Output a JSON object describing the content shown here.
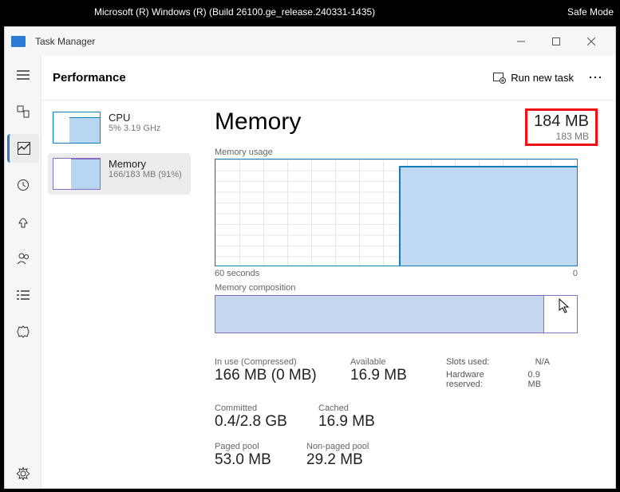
{
  "topbar": {
    "build": "Microsoft (R) Windows (R) (Build 26100.ge_release.240331-1435)",
    "mode": "Safe Mode"
  },
  "window": {
    "title": "Task Manager"
  },
  "header": {
    "title": "Performance",
    "runtask": "Run new task"
  },
  "sidebar": {
    "items": [
      {
        "name": "CPU",
        "stat": "5% 3.19 GHz"
      },
      {
        "name": "Memory",
        "stat": "166/183 MB (91%)"
      }
    ]
  },
  "detail": {
    "title": "Memory",
    "capacity": "184 MB",
    "usable": "183 MB",
    "usage_label": "Memory usage",
    "axis_left": "60 seconds",
    "axis_right": "0",
    "composition_label": "Memory composition",
    "stats": {
      "inuse_label": "In use (Compressed)",
      "inuse_val": "166 MB (0 MB)",
      "avail_label": "Available",
      "avail_val": "16.9 MB",
      "slots_label": "Slots used:",
      "slots_val": "N/A",
      "hwres_label": "Hardware reserved:",
      "hwres_val": "0.9 MB",
      "committed_label": "Committed",
      "committed_val": "0.4/2.8 GB",
      "cached_label": "Cached",
      "cached_val": "16.9 MB",
      "paged_label": "Paged pool",
      "paged_val": "53.0 MB",
      "nonpaged_label": "Non-paged pool",
      "nonpaged_val": "29.2 MB"
    }
  }
}
